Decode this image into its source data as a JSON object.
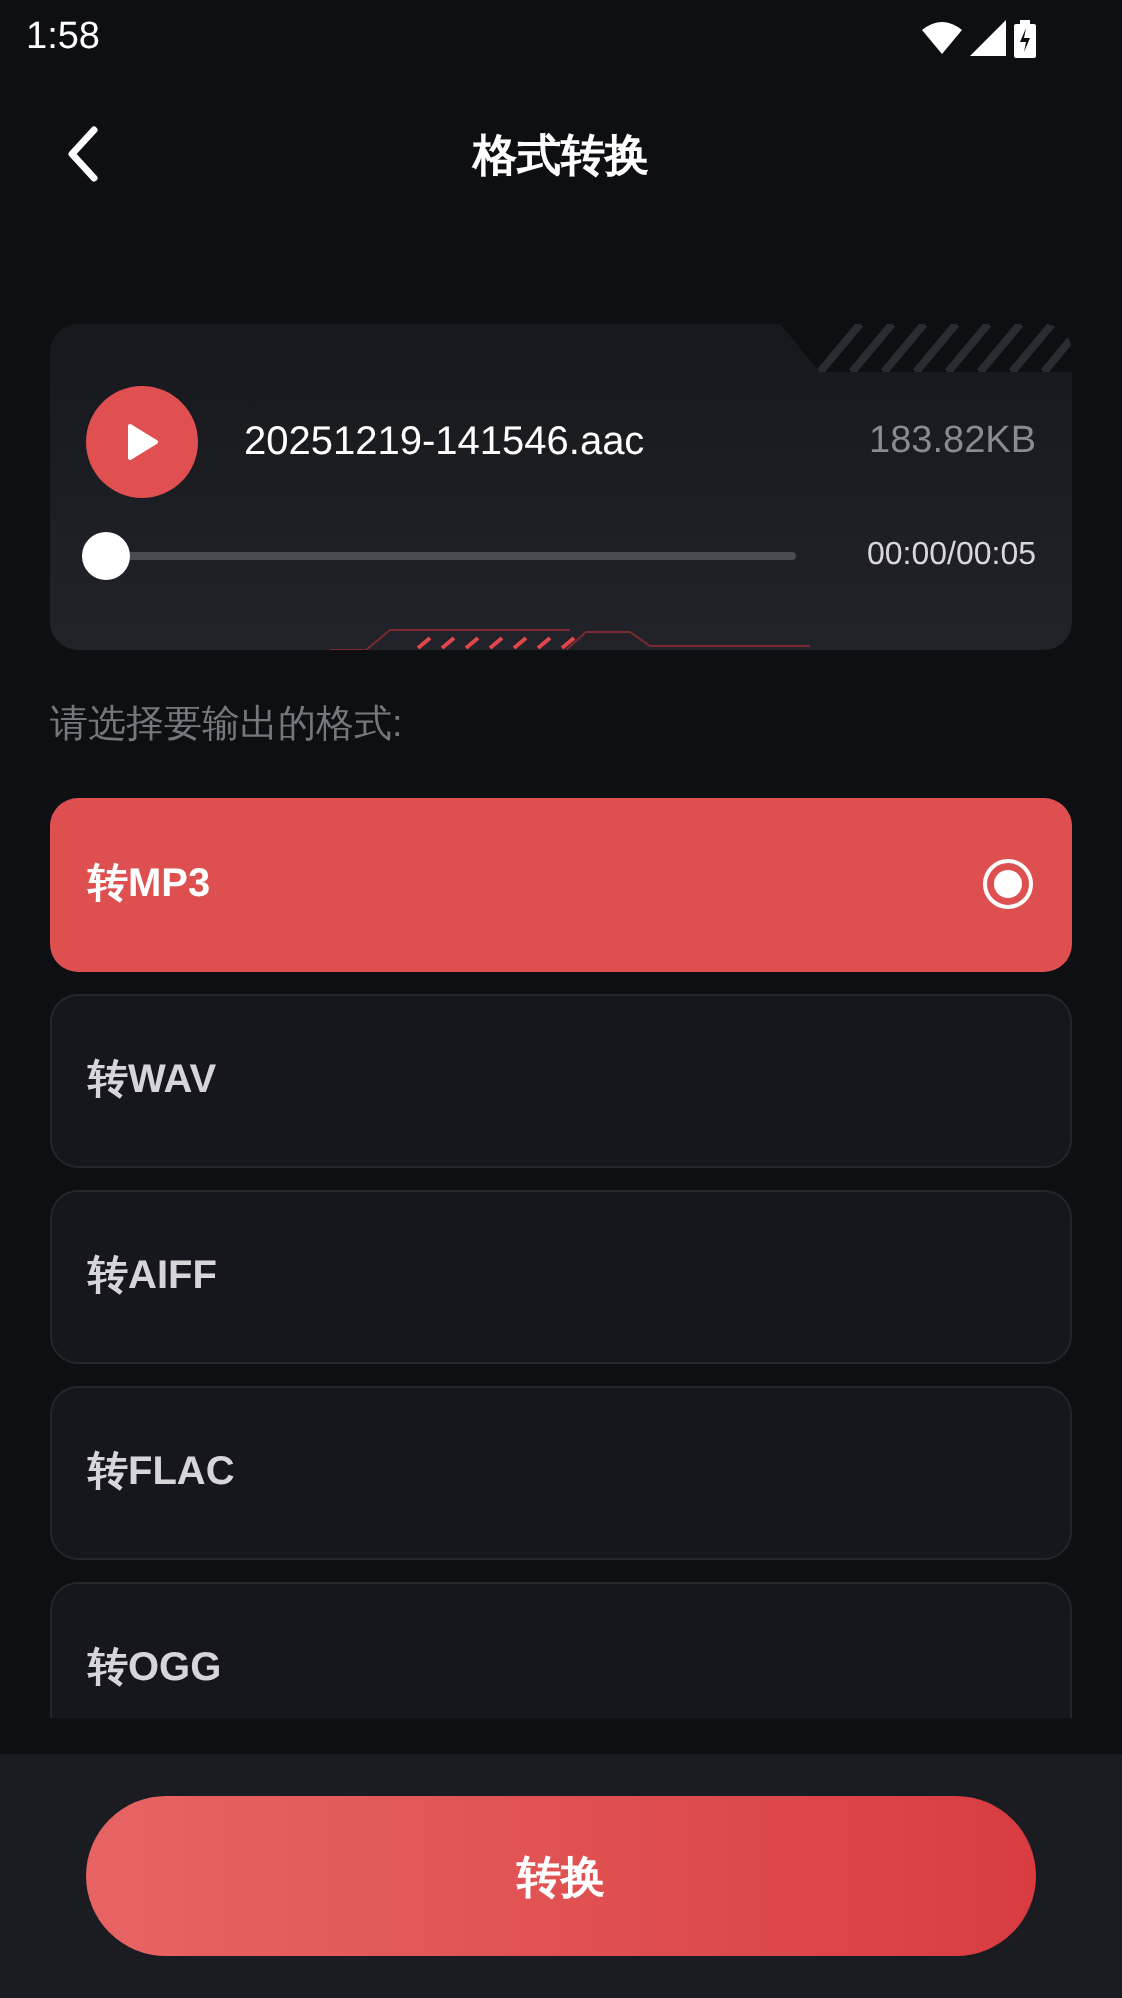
{
  "status_bar": {
    "time": "1:58"
  },
  "header": {
    "title": "格式转换"
  },
  "player": {
    "file_name": "20251219-141546.aac",
    "file_size": "183.82KB",
    "progress": {
      "level": 0
    },
    "time": "00:00/00:05"
  },
  "prompt": "请选择要输出的格式:",
  "formats": [
    {
      "label": "转MP3",
      "selected": true
    },
    {
      "label": "转WAV",
      "selected": false
    },
    {
      "label": "转AIFF",
      "selected": false
    },
    {
      "label": "转FLAC",
      "selected": false
    },
    {
      "label": "转OGG",
      "selected": false
    }
  ],
  "convert_button": "转换"
}
